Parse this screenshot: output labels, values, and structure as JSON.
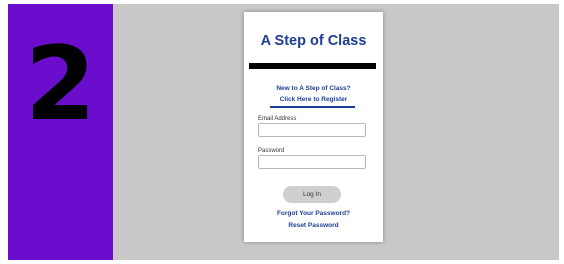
{
  "step": {
    "number": "2",
    "panel_color": "#6a0dcc"
  },
  "login_card": {
    "title": "A Step of Class",
    "register_prompt": "New to A Step of Class?",
    "register_link": "Click Here to Register",
    "email_label": "Email Address",
    "email_value": "",
    "password_label": "Password",
    "password_value": "",
    "login_button": "Log In",
    "forgot_password_link": "Forgot Your Password?",
    "reset_password_link": "Reset Password"
  },
  "colors": {
    "brand_blue": "#1c3f94",
    "background_gray": "#c8c8c8"
  }
}
